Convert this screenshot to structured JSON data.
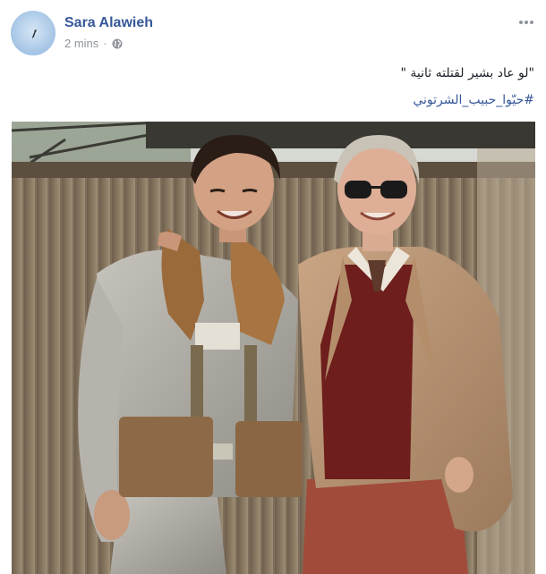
{
  "post": {
    "author_name": "Sara Alawieh",
    "timestamp": "2 mins",
    "separator": "·",
    "privacy_icon": "globe-icon",
    "more_icon": "more-options-icon",
    "text": "\"لو عاد بشير لقتلته ثانية \"",
    "hashtag": "#حيّوا_حبيب_الشرتوني",
    "colors": {
      "author": "#365899",
      "meta": "#90949c",
      "hashtag": "#365899"
    }
  }
}
